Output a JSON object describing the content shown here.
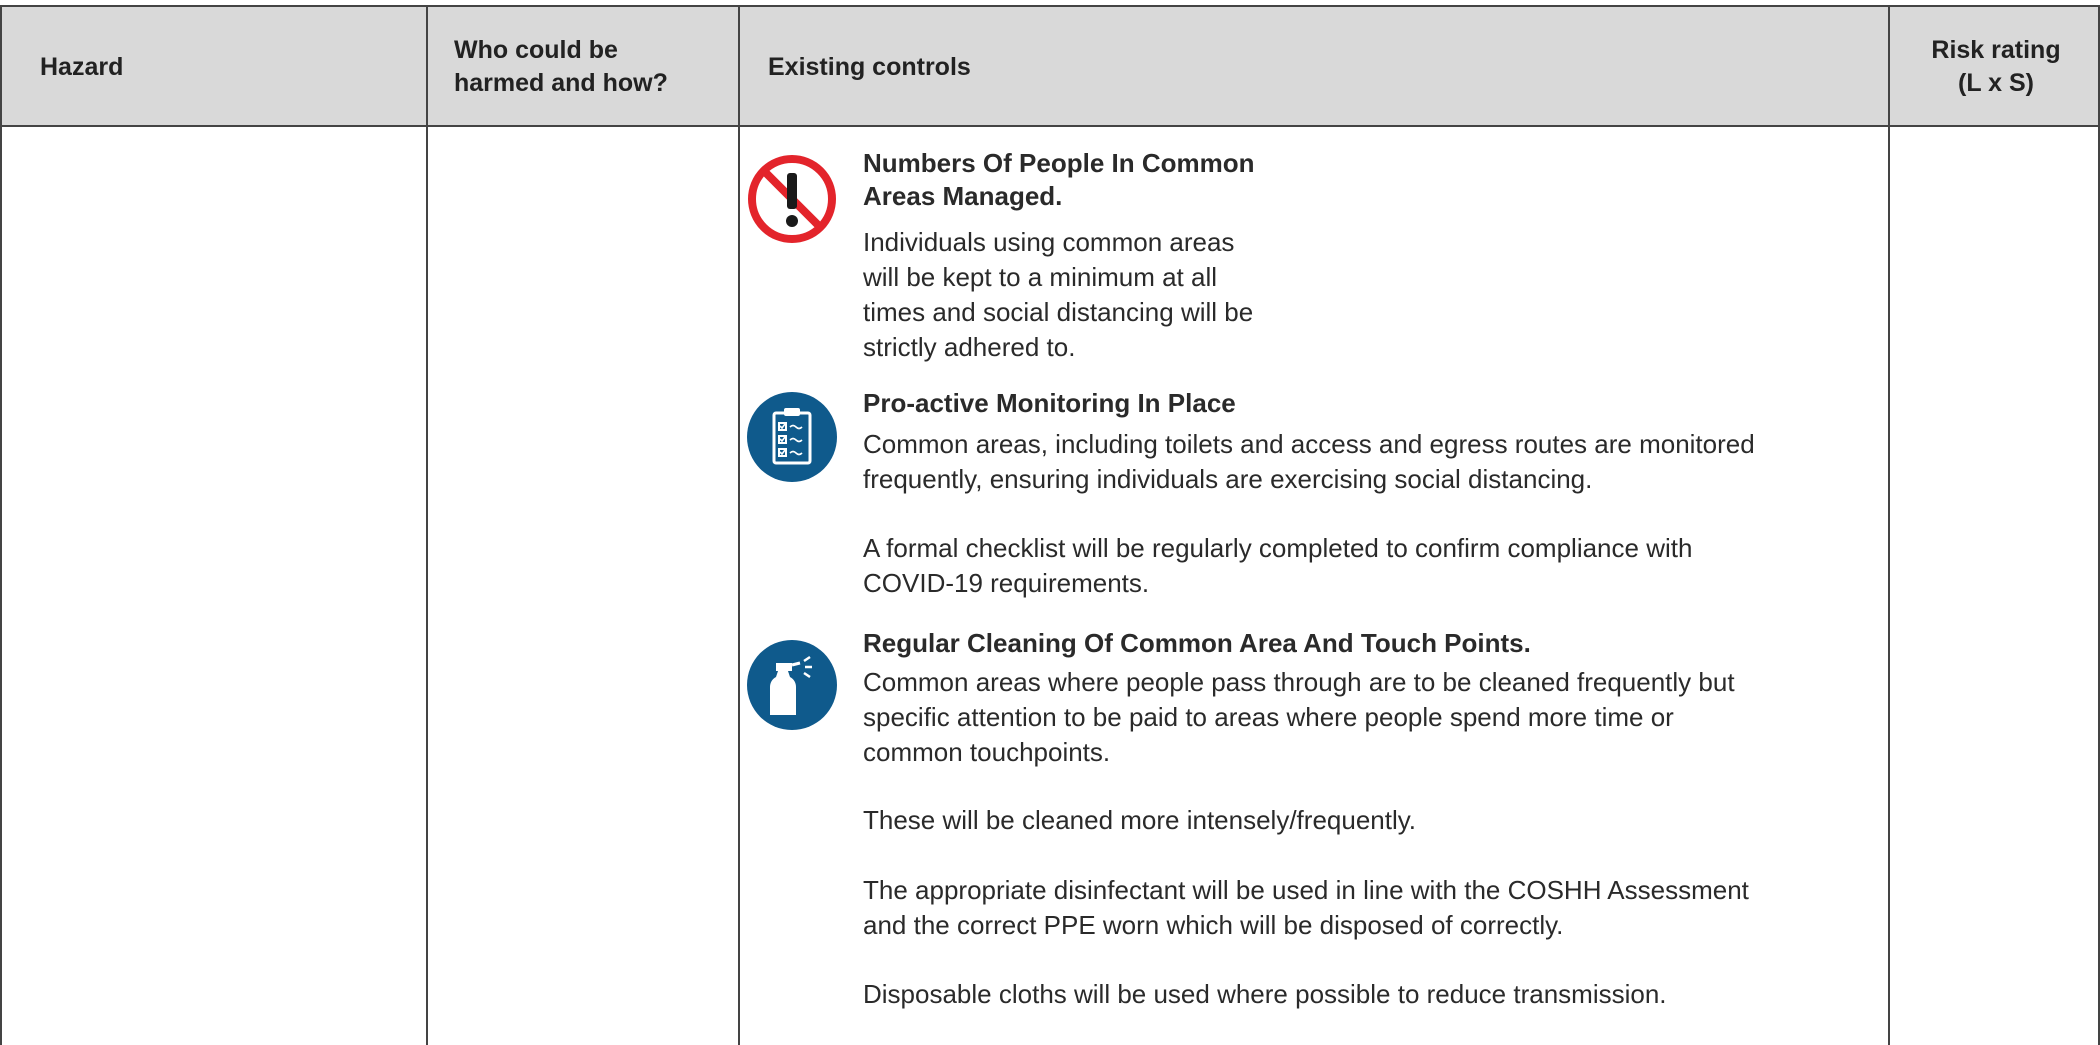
{
  "table": {
    "headers": {
      "hazard": "Hazard",
      "who": "Who could be\nharmed and how?",
      "controls": "Existing controls",
      "risk": "Risk rating\n(L x S)"
    },
    "controls": [
      {
        "icon": "no-entry-exclamation-icon",
        "title": "Numbers Of People In Common\nAreas Managed.",
        "paragraphs": [
          "Individuals using common areas\nwill be kept to a minimum at all\ntimes and social distancing will be\nstrictly adhered to."
        ]
      },
      {
        "icon": "clipboard-checklist-icon",
        "title": "Pro-active Monitoring In Place",
        "paragraphs": [
          "Common areas, including toilets and access and egress routes are monitored\nfrequently, ensuring individuals are exercising social distancing.",
          "A formal checklist will be regularly completed to confirm compliance with\nCOVID-19 requirements."
        ]
      },
      {
        "icon": "spray-bottle-icon",
        "title": "Regular Cleaning Of Common Area And Touch Points.",
        "paragraphs": [
          "Common areas where people pass through are to be cleaned frequently but\nspecific attention to be paid to areas where people spend more time or\ncommon touchpoints.",
          "These will be cleaned more intensely/frequently.",
          "The appropriate disinfectant will be used in line with the COSHH Assessment\nand the correct PPE worn which will be disposed of correctly.",
          "Disposable cloths will be used where possible to reduce transmission."
        ]
      }
    ]
  },
  "colors": {
    "header_bg": "#d9d9d9",
    "border": "#444444",
    "prohibition_red": "#e3242b",
    "mandatory_blue": "#0f5a8c"
  }
}
